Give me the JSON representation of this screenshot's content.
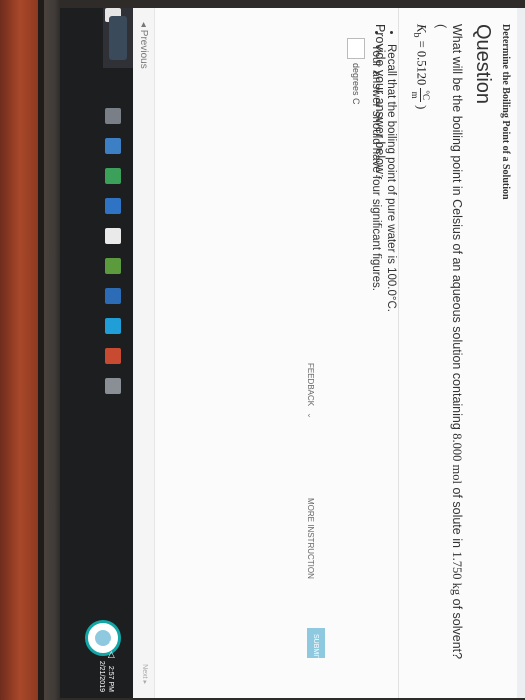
{
  "breadcrumb": "Determine the Boiling Point of a Solution",
  "question": {
    "heading": "Question",
    "text_part1": "What will be the boiling point in Celsius of an aqueous solution containing ",
    "moles": "8.000 mol",
    "text_part2": " of solute in ",
    "mass": "1.750 kg",
    "text_part3": " of solvent? (",
    "kb_symbol": "K",
    "kb_sub": "b",
    "kb_value": " = 0.5120 ",
    "kb_unit_num": "°C",
    "kb_unit_den": "m",
    "kb_close": ")",
    "bullets": [
      "Recall that the boiling point of pure water is 100.0°C.",
      "Your answer should have four significant figures."
    ]
  },
  "answer": {
    "prompt": "Provide your answer below:",
    "unit": "degrees C",
    "value": ""
  },
  "actions": {
    "feedback": "FEEDBACK",
    "more_instruction": "MORE INSTRUCTION",
    "submit": "SUBMIT"
  },
  "navigation": {
    "previous": "◂ Previous",
    "next": "Next ▸"
  },
  "taskbar": {
    "time": "2:57 PM",
    "date": "2/21/2019"
  },
  "colors": {
    "accent": "#13a6a7",
    "submit_bg": "#8fc9df"
  }
}
